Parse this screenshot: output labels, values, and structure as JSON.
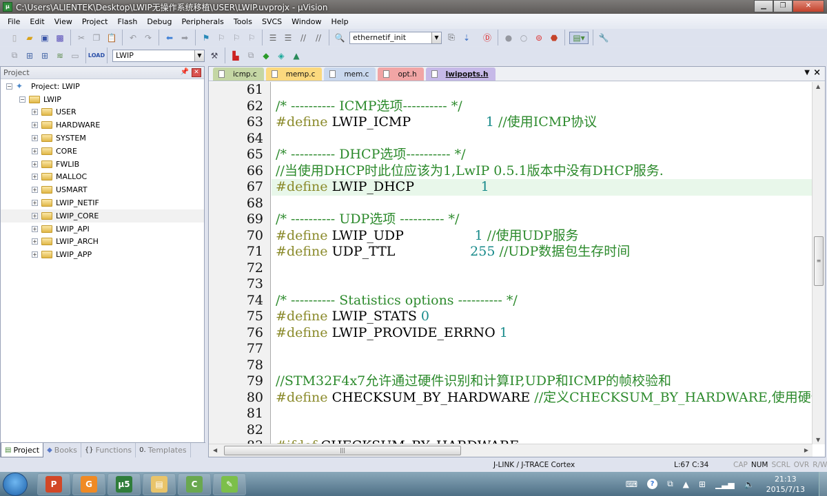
{
  "window": {
    "title": "C:\\Users\\ALIENTEK\\Desktop\\LWIP无操作系统移植\\USER\\LWIP.uvprojx - µVision",
    "app_icon": "uvision-icon",
    "controls": {
      "minimize": "minimize-icon",
      "restore": "restore-icon",
      "close": "close-icon"
    }
  },
  "menu": [
    "File",
    "Edit",
    "View",
    "Project",
    "Flash",
    "Debug",
    "Peripherals",
    "Tools",
    "SVCS",
    "Window",
    "Help"
  ],
  "toolbar1": {
    "groups": [
      [
        "new-file-icon",
        "open-file-icon",
        "save-icon",
        "save-all-icon"
      ],
      [
        "cut-icon",
        "copy-icon",
        "paste-icon"
      ],
      [
        "undo-icon",
        "redo-icon"
      ],
      [
        "navigate-back-icon",
        "navigate-forward-icon"
      ],
      [
        "bookmark-icon",
        "prev-bookmark-icon",
        "next-bookmark-icon",
        "clear-bookmarks-icon"
      ],
      [
        "indent-icon",
        "unindent-icon",
        "comment-icon",
        "uncomment-icon"
      ]
    ],
    "find_combo_value": "ethernetif_init",
    "after_combo": [
      "find-in-files-icon",
      "incremental-find-icon",
      "debug-session-icon",
      "breakpoint-icon",
      "disable-breakpoint-icon",
      "disable-all-breakpoints-icon",
      "kill-breakpoints-icon",
      "window-layout-icon",
      "configure-icon"
    ]
  },
  "toolbar2": {
    "build_icons": [
      "translate-icon",
      "build-icon",
      "rebuild-icon",
      "batch-build-icon",
      "stop-build-icon",
      "load-icon"
    ],
    "target_combo_value": "LWIP",
    "after_combo": [
      "options-for-target-icon",
      "manage-project-icon",
      "select-packs-icon",
      "manage-rte-icon",
      "pack-installer-icon",
      "manage-components-icon"
    ]
  },
  "project_panel": {
    "title": "Project",
    "root": "Project: LWIP",
    "target": "LWIP",
    "groups": [
      "USER",
      "HARDWARE",
      "SYSTEM",
      "CORE",
      "FWLIB",
      "MALLOC",
      "USMART",
      "LWIP_NETIF",
      "LWIP_CORE",
      "LWIP_API",
      "LWIP_ARCH",
      "LWIP_APP"
    ],
    "selected_group": "LWIP_CORE",
    "tabs": [
      {
        "label": "Project",
        "icon": "project-icon",
        "active": true
      },
      {
        "label": "Books",
        "icon": "books-icon",
        "active": false
      },
      {
        "label": "Functions",
        "icon": "functions-icon",
        "active": false
      },
      {
        "label": "Templates",
        "icon": "templates-icon",
        "active": false
      }
    ]
  },
  "editor": {
    "tabs": [
      {
        "label": "icmp.c",
        "color": "#c4d6a4",
        "active": false
      },
      {
        "label": "memp.c",
        "color": "#fbd97e",
        "active": false
      },
      {
        "label": "mem.c",
        "color": "#c9d8ee",
        "active": false
      },
      {
        "label": "opt.h",
        "color": "#f1a5a5",
        "active": false
      },
      {
        "label": "lwipopts.h",
        "color": "#c6b9e8",
        "active": true
      }
    ],
    "highlight_line": 67,
    "lines": [
      {
        "n": "61",
        "parts": []
      },
      {
        "n": "62",
        "parts": [
          {
            "t": "cm",
            "v": "/* ---------- ICMP选项---------- */"
          }
        ]
      },
      {
        "n": "63",
        "parts": [
          {
            "t": "kw",
            "v": "#define"
          },
          {
            "t": "tok",
            "v": " LWIP_ICMP                  "
          },
          {
            "t": "num",
            "v": "1"
          },
          {
            "t": "cm",
            "v": " //使用ICMP协议"
          }
        ]
      },
      {
        "n": "64",
        "parts": []
      },
      {
        "n": "65",
        "parts": [
          {
            "t": "cm",
            "v": "/* ---------- DHCP选项---------- */"
          }
        ]
      },
      {
        "n": "66",
        "parts": [
          {
            "t": "cm",
            "v": "//当使用DHCP时此位应该为1,LwIP 0.5.1版本中没有DHCP服务."
          }
        ]
      },
      {
        "n": "67",
        "parts": [
          {
            "t": "kw",
            "v": "#define"
          },
          {
            "t": "tok",
            "v": " LWIP_DHCP                "
          },
          {
            "t": "num",
            "v": "1"
          }
        ]
      },
      {
        "n": "68",
        "parts": []
      },
      {
        "n": "69",
        "parts": [
          {
            "t": "cm",
            "v": "/* ---------- UDP选项 ---------- */"
          }
        ]
      },
      {
        "n": "70",
        "parts": [
          {
            "t": "kw",
            "v": "#define"
          },
          {
            "t": "tok",
            "v": " LWIP_UDP                 "
          },
          {
            "t": "num",
            "v": "1"
          },
          {
            "t": "cm",
            "v": " //使用UDP服务"
          }
        ]
      },
      {
        "n": "71",
        "parts": [
          {
            "t": "kw",
            "v": "#define"
          },
          {
            "t": "tok",
            "v": " UDP_TTL                  "
          },
          {
            "t": "num",
            "v": "255"
          },
          {
            "t": "cm",
            "v": " //UDP数据包生存时间"
          }
        ]
      },
      {
        "n": "72",
        "parts": []
      },
      {
        "n": "73",
        "parts": []
      },
      {
        "n": "74",
        "parts": [
          {
            "t": "cm",
            "v": "/* ---------- Statistics options ---------- */"
          }
        ]
      },
      {
        "n": "75",
        "parts": [
          {
            "t": "kw",
            "v": "#define"
          },
          {
            "t": "tok",
            "v": " LWIP_STATS "
          },
          {
            "t": "num",
            "v": "0"
          }
        ]
      },
      {
        "n": "76",
        "parts": [
          {
            "t": "kw",
            "v": "#define"
          },
          {
            "t": "tok",
            "v": " LWIP_PROVIDE_ERRNO "
          },
          {
            "t": "num",
            "v": "1"
          }
        ]
      },
      {
        "n": "77",
        "parts": []
      },
      {
        "n": "78",
        "parts": []
      },
      {
        "n": "79",
        "parts": [
          {
            "t": "cm",
            "v": "//STM32F4x7允许通过硬件识别和计算IP,UDP和ICMP的帧校验和"
          }
        ]
      },
      {
        "n": "80",
        "parts": [
          {
            "t": "kw",
            "v": "#define"
          },
          {
            "t": "tok",
            "v": " CHECKSUM_BY_HARDWARE "
          },
          {
            "t": "cm",
            "v": "//定义CHECKSUM_BY_HARDWARE,使用硬件帧校验"
          }
        ]
      },
      {
        "n": "81",
        "parts": []
      },
      {
        "n": "82",
        "parts": []
      },
      {
        "n": "83",
        "parts": [
          {
            "t": "kw",
            "v": "#ifdef"
          },
          {
            "t": "tok",
            "v": " CHECKSUM_BY_HARDWARE"
          }
        ]
      }
    ]
  },
  "status": {
    "debugger": "J-LINK / J-TRACE Cortex",
    "cursor": "L:67 C:34",
    "indicators": [
      {
        "label": "CAP",
        "on": false
      },
      {
        "label": "NUM",
        "on": true
      },
      {
        "label": "SCRL",
        "on": false
      },
      {
        "label": "OVR",
        "on": false
      },
      {
        "label": "R/W",
        "on": false
      }
    ]
  },
  "taskbar": {
    "apps": [
      {
        "name": "powerpoint",
        "glyph": "P",
        "color": "#d24726"
      },
      {
        "name": "foxit-pdf",
        "glyph": "G",
        "color": "#f08a24"
      },
      {
        "name": "uvision",
        "glyph": "µ5",
        "color": "#2f7d3a"
      },
      {
        "name": "file-explorer",
        "glyph": "▤",
        "color": "#e9c46a"
      },
      {
        "name": "camtasia",
        "glyph": "C",
        "color": "#6aa84f"
      },
      {
        "name": "notepad-plus",
        "glyph": "✎",
        "color": "#7cbf4a"
      }
    ],
    "time": "21:13",
    "date": "2015/7/13"
  }
}
